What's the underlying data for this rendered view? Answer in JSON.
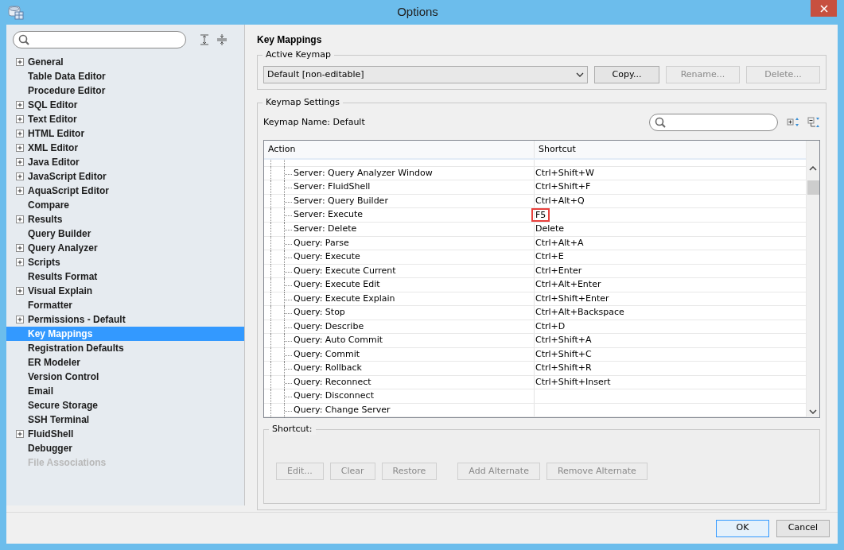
{
  "window": {
    "title": "Options"
  },
  "sidebar": {
    "items": [
      {
        "label": "General",
        "expandable": true,
        "selected": false,
        "disabled": false
      },
      {
        "label": "Table Data Editor",
        "expandable": false,
        "selected": false,
        "disabled": false
      },
      {
        "label": "Procedure Editor",
        "expandable": false,
        "selected": false,
        "disabled": false
      },
      {
        "label": "SQL Editor",
        "expandable": true,
        "selected": false,
        "disabled": false
      },
      {
        "label": "Text Editor",
        "expandable": true,
        "selected": false,
        "disabled": false
      },
      {
        "label": "HTML Editor",
        "expandable": true,
        "selected": false,
        "disabled": false
      },
      {
        "label": "XML Editor",
        "expandable": true,
        "selected": false,
        "disabled": false
      },
      {
        "label": "Java Editor",
        "expandable": true,
        "selected": false,
        "disabled": false
      },
      {
        "label": "JavaScript Editor",
        "expandable": true,
        "selected": false,
        "disabled": false
      },
      {
        "label": "AquaScript Editor",
        "expandable": true,
        "selected": false,
        "disabled": false
      },
      {
        "label": "Compare",
        "expandable": false,
        "selected": false,
        "disabled": false
      },
      {
        "label": "Results",
        "expandable": true,
        "selected": false,
        "disabled": false
      },
      {
        "label": "Query Builder",
        "expandable": false,
        "selected": false,
        "disabled": false
      },
      {
        "label": "Query Analyzer",
        "expandable": true,
        "selected": false,
        "disabled": false
      },
      {
        "label": "Scripts",
        "expandable": true,
        "selected": false,
        "disabled": false
      },
      {
        "label": "Results Format",
        "expandable": false,
        "selected": false,
        "disabled": false
      },
      {
        "label": "Visual Explain",
        "expandable": true,
        "selected": false,
        "disabled": false
      },
      {
        "label": "Formatter",
        "expandable": false,
        "selected": false,
        "disabled": false
      },
      {
        "label": "Permissions - Default",
        "expandable": true,
        "selected": false,
        "disabled": false
      },
      {
        "label": "Key Mappings",
        "expandable": false,
        "selected": true,
        "disabled": false
      },
      {
        "label": "Registration Defaults",
        "expandable": false,
        "selected": false,
        "disabled": false
      },
      {
        "label": "ER Modeler",
        "expandable": false,
        "selected": false,
        "disabled": false
      },
      {
        "label": "Version Control",
        "expandable": false,
        "selected": false,
        "disabled": false
      },
      {
        "label": "Email",
        "expandable": false,
        "selected": false,
        "disabled": false
      },
      {
        "label": "Secure Storage",
        "expandable": false,
        "selected": false,
        "disabled": false
      },
      {
        "label": "SSH Terminal",
        "expandable": false,
        "selected": false,
        "disabled": false
      },
      {
        "label": "FluidShell",
        "expandable": true,
        "selected": false,
        "disabled": false
      },
      {
        "label": "Debugger",
        "expandable": false,
        "selected": false,
        "disabled": false
      },
      {
        "label": "File Associations",
        "expandable": false,
        "selected": false,
        "disabled": true
      }
    ]
  },
  "page_title": "Key Mappings",
  "active_keymap": {
    "legend": "Active Keymap",
    "value": "Default [non-editable]",
    "buttons": [
      {
        "label": "Copy...",
        "disabled": false
      },
      {
        "label": "Rename...",
        "disabled": true
      },
      {
        "label": "Delete...",
        "disabled": true
      }
    ]
  },
  "keymap_settings": {
    "legend": "Keymap Settings",
    "name_label": "Keymap Name: Default",
    "table": {
      "columns": [
        "Action",
        "Shortcut"
      ],
      "rows": [
        {
          "action": "Server: Query Analyzer Window",
          "shortcut": "Ctrl+Shift+W",
          "highlighted": false
        },
        {
          "action": "Server: FluidShell",
          "shortcut": "Ctrl+Shift+F",
          "highlighted": false
        },
        {
          "action": "Server: Query Builder",
          "shortcut": "Ctrl+Alt+Q",
          "highlighted": false
        },
        {
          "action": "Server: Execute",
          "shortcut": "F5",
          "highlighted": true
        },
        {
          "action": "Server: Delete",
          "shortcut": "Delete",
          "highlighted": false
        },
        {
          "action": "Query: Parse",
          "shortcut": "Ctrl+Alt+A",
          "highlighted": false
        },
        {
          "action": "Query: Execute",
          "shortcut": "Ctrl+E",
          "highlighted": false
        },
        {
          "action": "Query: Execute Current",
          "shortcut": "Ctrl+Enter",
          "highlighted": false
        },
        {
          "action": "Query: Execute Edit",
          "shortcut": "Ctrl+Alt+Enter",
          "highlighted": false
        },
        {
          "action": "Query: Execute Explain",
          "shortcut": "Ctrl+Shift+Enter",
          "highlighted": false
        },
        {
          "action": "Query: Stop",
          "shortcut": "Ctrl+Alt+Backspace",
          "highlighted": false
        },
        {
          "action": "Query: Describe",
          "shortcut": "Ctrl+D",
          "highlighted": false
        },
        {
          "action": "Query: Auto Commit",
          "shortcut": "Ctrl+Shift+A",
          "highlighted": false
        },
        {
          "action": "Query: Commit",
          "shortcut": "Ctrl+Shift+C",
          "highlighted": false
        },
        {
          "action": "Query: Rollback",
          "shortcut": "Ctrl+Shift+R",
          "highlighted": false
        },
        {
          "action": "Query: Reconnect",
          "shortcut": "Ctrl+Shift+Insert",
          "highlighted": false
        },
        {
          "action": "Query: Disconnect",
          "highlighted": false
        },
        {
          "action": "Query: Change Server",
          "highlighted": false
        }
      ]
    }
  },
  "shortcut_group": {
    "legend": "Shortcut:",
    "button_groups": [
      [
        {
          "label": "Edit...",
          "disabled": true
        },
        {
          "label": "Clear",
          "disabled": true
        },
        {
          "label": "Restore",
          "disabled": true
        }
      ],
      [
        {
          "label": "Add Alternate",
          "disabled": true
        },
        {
          "label": "Remove Alternate",
          "disabled": true
        }
      ]
    ]
  },
  "footer_buttons": [
    {
      "label": "OK",
      "default": true
    },
    {
      "label": "Cancel",
      "default": false
    }
  ]
}
